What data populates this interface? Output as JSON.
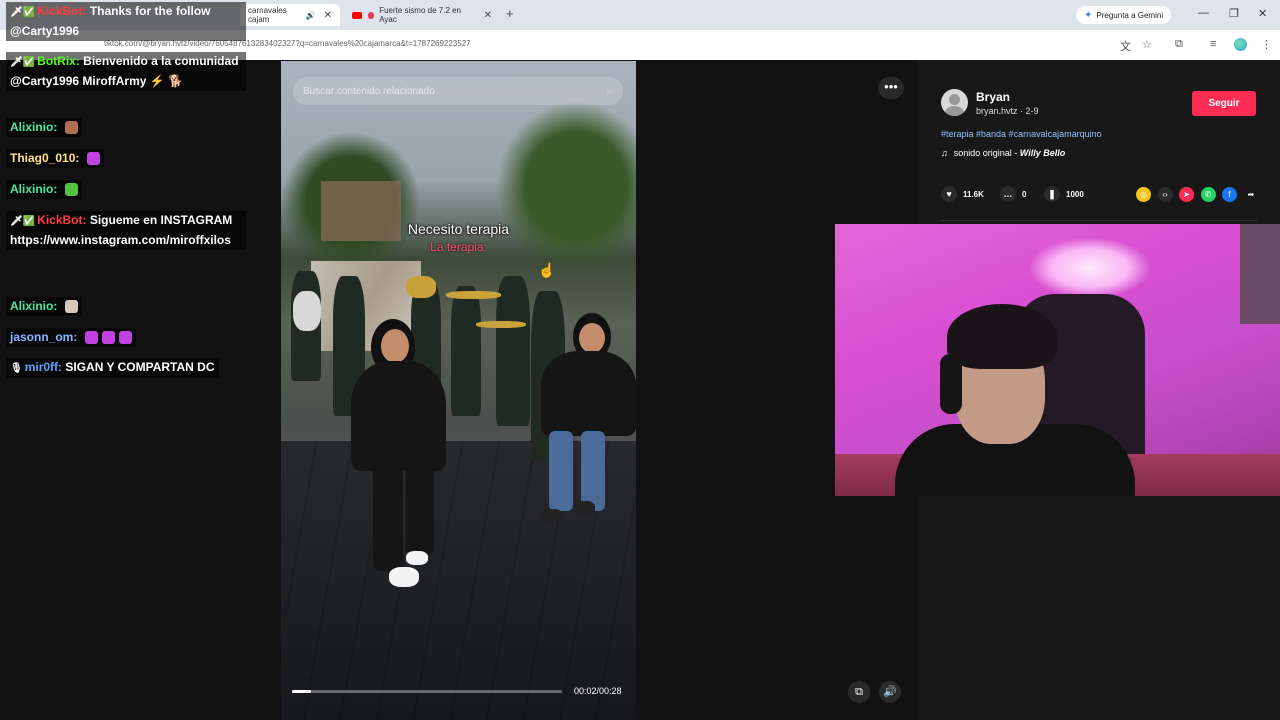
{
  "browser": {
    "tabs": [
      {
        "label": "carnavales cajam",
        "active": true
      },
      {
        "label": "Fuerte sismo de 7.2 en Ayac",
        "active": false
      }
    ],
    "gemini_label": "Pregunta a Gemini",
    "url": "tiktok.com/@bryan.hvtz/video/7605487613283402327?q=carnavales%20cajamarca&t=1787269223527"
  },
  "video": {
    "search_placeholder": "Buscar contenido relacionado",
    "caption_line1": "Necesito terapia",
    "caption_line2": "La terapia:",
    "time": "00:02/00:28",
    "progress": 0.07
  },
  "author": {
    "name": "Bryan",
    "handle": "bryan.hvtz · 2-9",
    "follow_label": "Seguir",
    "hashtags": "#terapia #banda #carnavalcajamarquino",
    "sound_label": "sonido original - ",
    "sound_artist": "Willy Bello"
  },
  "stats": {
    "likes": "11.6K",
    "comments": "0",
    "saves": "1000"
  },
  "share_icons": [
    {
      "name": "coin-share-icon",
      "color": "#f5c518",
      "glyph": "◎"
    },
    {
      "name": "embed-share-icon",
      "color": "#2b2b2b",
      "glyph": "‹›"
    },
    {
      "name": "send-share-icon",
      "color": "#fe2c55",
      "glyph": "➤"
    },
    {
      "name": "whatsapp-share-icon",
      "color": "#25d366",
      "glyph": "✆"
    },
    {
      "name": "facebook-share-icon",
      "color": "#1877f2",
      "glyph": "f"
    },
    {
      "name": "forward-share-icon",
      "color": "transparent",
      "glyph": "➦"
    }
  ],
  "chat": {
    "messages": [
      {
        "user": "KickBot",
        "user_color": "#ff3b3b",
        "badges": "🗡✅",
        "text": "Thanks for the follow @Carty1996"
      },
      {
        "user": "BotRix",
        "user_color": "#53fc18",
        "badges": "🗡✅",
        "text": "Bienvenido a la comunidad @Carty1996 MiroffArmy ⚡ 🐕"
      },
      {
        "user": "Alixinio",
        "user_color": "#4ee6a0",
        "badges": "",
        "text": "",
        "emote_color": "#b07050"
      },
      {
        "user": "Thiag0_010",
        "user_color": "#ffe08a",
        "badges": "",
        "text": "",
        "emote_color": "#c040e0"
      },
      {
        "user": "Alixinio",
        "user_color": "#4ee6a0",
        "badges": "",
        "text": "",
        "emote_color": "#53c040"
      },
      {
        "user": "KickBot",
        "user_color": "#ff3b3b",
        "badges": "🗡✅",
        "text": "Sigueme en INSTAGRAM https://www.instagram.com/miroffxilos"
      },
      {
        "user": "Alixinio",
        "user_color": "#4ee6a0",
        "badges": "",
        "text": "",
        "emote_color": "#d9c8b8"
      },
      {
        "user": "jasonn_om",
        "user_color": "#8ab4ff",
        "badges": "",
        "text": "",
        "emote_color": "#c040e0",
        "emote_count": 3
      },
      {
        "user": "mir0ff",
        "user_color": "#5aa0ff",
        "badges": "🎙",
        "text": "SIGAN Y COMPARTAN DC"
      }
    ]
  }
}
